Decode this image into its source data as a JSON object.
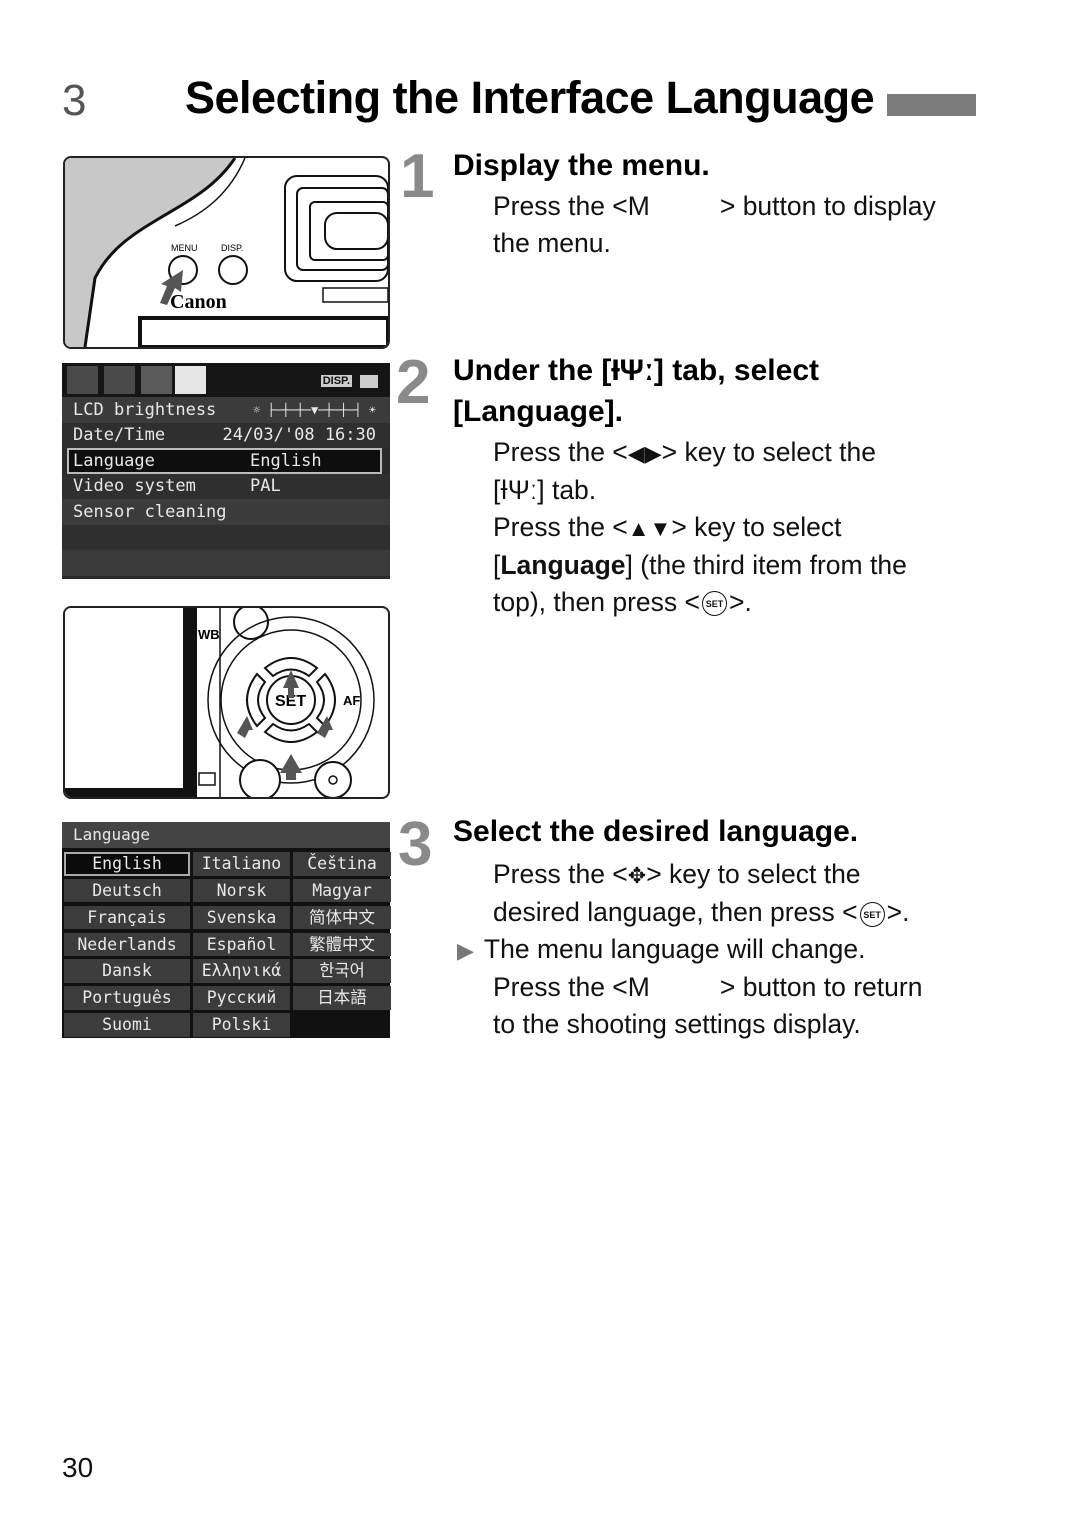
{
  "page": {
    "chapter_number": "3",
    "title": "Selecting the Interface Language",
    "page_number": "30"
  },
  "steps": [
    {
      "number": "1",
      "title": "Display the menu.",
      "lines": [
        "Press the <M",
        "> button to display",
        "the menu."
      ]
    },
    {
      "number": "2",
      "title_line1": "Under the [ƗΨː] tab, select",
      "title_line2": "[Language].",
      "text": {
        "l1a": "Press the <",
        "l1b": "> key to select the",
        "l2": "[ƗΨː] tab.",
        "l3a": "Press the <",
        "l3b": "> key to select",
        "l4a": "[",
        "l4b": "Language",
        "l4c": "] (the third item from the",
        "l5a": "top), then press <",
        "l5b": ">."
      }
    },
    {
      "number": "3",
      "title": "Select the desired language.",
      "text": {
        "l1a": "Press the <",
        "l1b": "> key to select the",
        "l2a": "desired language, then press <",
        "l2b": ">.",
        "l3": "The menu language will change.",
        "l4a": "Press the <M",
        "l4b": "> button to return",
        "l5": "to the shooting settings display."
      }
    }
  ],
  "icons": {
    "set_button": "SET",
    "left_right_keys": "◀▶",
    "up_down_keys": "▲▼",
    "cross_keys": "✥",
    "result_bullet": "▶"
  },
  "illustration_1": {
    "labels": {
      "menu": "MENU",
      "disp": "DISP.",
      "brand": "Canon"
    }
  },
  "illustration_2": {
    "labels": {
      "set": "SET",
      "wb": "WB",
      "af": "AF"
    }
  },
  "setup_menu": {
    "disp_label": "DISP.",
    "rows": [
      {
        "label": "LCD brightness",
        "value": "☼ ├─┼─┼─▼─┼─┼─┤ ☀"
      },
      {
        "label": "Date/Time",
        "value": "24/03/'08 16:30"
      },
      {
        "label": "Language",
        "value": "English",
        "selected": true
      },
      {
        "label": "Video system",
        "value": "PAL"
      },
      {
        "label": "Sensor cleaning",
        "value": ""
      },
      {
        "label": "",
        "value": ""
      },
      {
        "label": "",
        "value": ""
      }
    ]
  },
  "language_menu": {
    "header": "Language",
    "selected": "English",
    "options": [
      "English",
      "Italiano",
      "Čeština",
      "Deutsch",
      "Norsk",
      "Magyar",
      "Français",
      "Svenska",
      "简体中文",
      "Nederlands",
      "Español",
      "繁體中文",
      "Dansk",
      "Ελληνικά",
      "한국어",
      "Português",
      "Русский",
      "日本語",
      "Suomi",
      "Polski"
    ]
  }
}
